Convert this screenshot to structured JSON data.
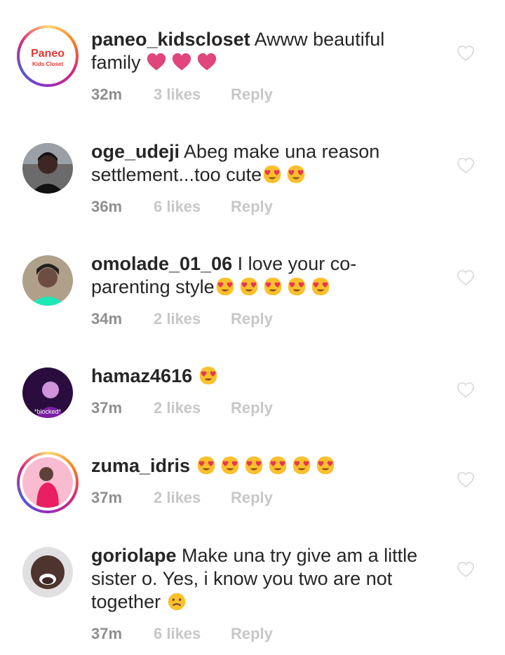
{
  "comments": [
    {
      "username": "paneo_kidscloset",
      "text": "Awww beautiful family",
      "time": "32m",
      "likes": "3 likes",
      "reply": "Reply",
      "avatar_logo_text_1": "Paneo",
      "avatar_logo_text_2": "Kids Closet"
    },
    {
      "username": "oge_udeji",
      "text": "Abeg make una reason settlement...too cute",
      "time": "36m",
      "likes": "6 likes",
      "reply": "Reply"
    },
    {
      "username": "omolade_01_06",
      "text": "I love your co-parenting style",
      "time": "34m",
      "likes": "2 likes",
      "reply": "Reply"
    },
    {
      "username": "hamaz4616",
      "text": "",
      "time": "37m",
      "likes": "2 likes",
      "reply": "Reply",
      "avatar_caption": "*blocked*"
    },
    {
      "username": "zuma_idris",
      "text": "",
      "time": "37m",
      "likes": "2 likes",
      "reply": "Reply"
    },
    {
      "username": "goriolape",
      "text": "Make una try give am a little sister o. Yes, i know you two are not together",
      "time": "37m",
      "likes": "6 likes",
      "reply": "Reply"
    }
  ],
  "colors": {
    "meta_time": "#8e8e8e",
    "meta_faded": "#c7c7c7",
    "heart_emoji": "#e0457b",
    "emoji_face": "#fbc02d"
  },
  "icons": {
    "like": "heart-outline-icon",
    "emoji_hearts": "heart-eyes-emoji",
    "emoji_sad": "sad-face-emoji",
    "emoji_heart": "heart-emoji"
  }
}
